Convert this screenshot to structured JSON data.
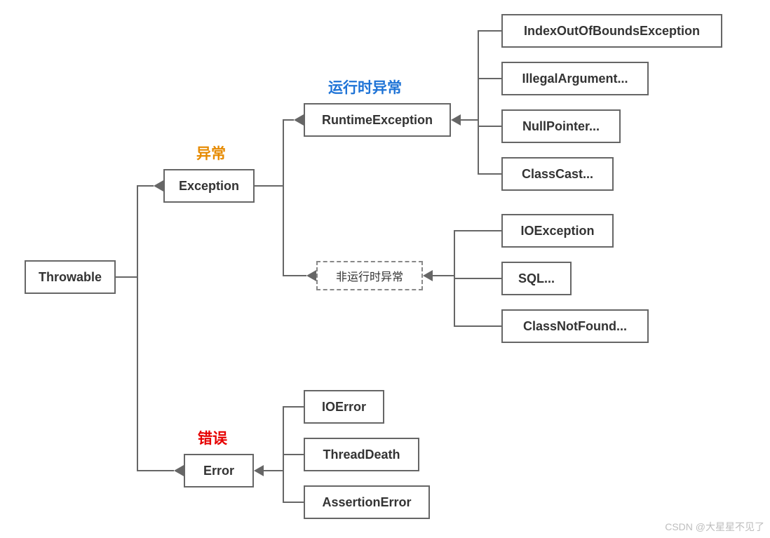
{
  "chart_data": {
    "type": "tree",
    "root": "Throwable",
    "children": [
      {
        "name": "Exception",
        "annotation": "异常",
        "children": [
          {
            "name": "RuntimeException",
            "annotation": "运行时异常",
            "children": [
              "IndexOutOfBoundsException",
              "IllegalArgument...",
              "NullPointer...",
              "ClassCast..."
            ]
          },
          {
            "name": "非运行时异常",
            "style": "dashed",
            "children": [
              "IOException",
              "SQL...",
              "ClassNotFound..."
            ]
          }
        ]
      },
      {
        "name": "Error",
        "annotation": "错误",
        "children": [
          "IOError",
          "ThreadDeath",
          "AssertionError"
        ]
      }
    ]
  },
  "nodes": {
    "throwable": "Throwable",
    "exception": "Exception",
    "error": "Error",
    "runtime_exception": "RuntimeException",
    "non_runtime_exception": "非运行时异常",
    "ioobe": "IndexOutOfBoundsException",
    "illegal_arg": "IllegalArgument...",
    "null_pointer": "NullPointer...",
    "class_cast": "ClassCast...",
    "io_exception": "IOException",
    "sql": "SQL...",
    "class_not_found": "ClassNotFound...",
    "io_error": "IOError",
    "thread_death": "ThreadDeath",
    "assertion_error": "AssertionError"
  },
  "labels": {
    "exception_cn": "异常",
    "runtime_cn": "运行时异常",
    "error_cn": "错误"
  },
  "watermark": "CSDN @大星星不见了"
}
